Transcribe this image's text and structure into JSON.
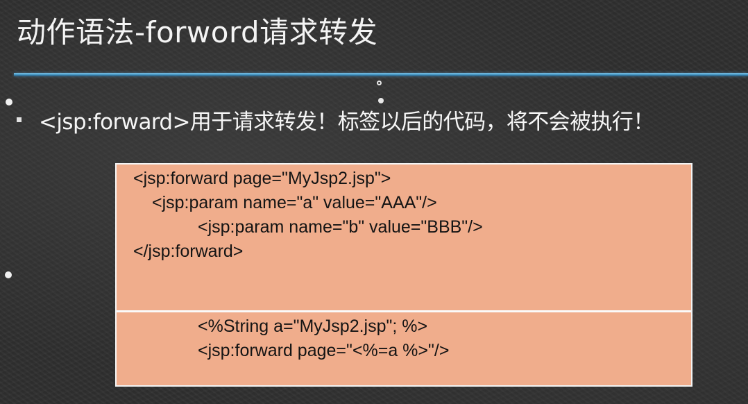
{
  "slide": {
    "title": "动作语法-forword请求转发",
    "bullet": "<jsp:forward>用于请求转发！标签以后的代码，将不会被执行！"
  },
  "code_box": {
    "top_lines": [
      "<jsp:forward page=\"MyJsp2.jsp\">",
      "<jsp:param name=\"a\" value=\"AAA\"/>",
      "<jsp:param name=\"b\" value=\"BBB\"/>",
      "</jsp:forward>"
    ],
    "bottom_lines": [
      "<%String a=\"MyJsp2.jsp\"; %>",
      "<jsp:forward page=\"<%=a %>\"/>"
    ]
  },
  "colors": {
    "background": "#2f2f2f",
    "title_rule": "#3c8fbf",
    "code_box_fill": "#f0ad8c",
    "code_text": "#141414"
  }
}
